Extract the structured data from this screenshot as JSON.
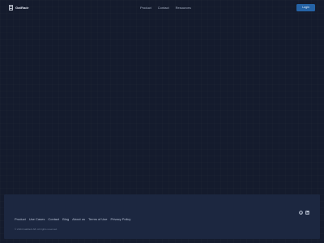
{
  "header": {
    "brand": "GatRadr",
    "nav": [
      "Product",
      "Contact",
      "Resources"
    ],
    "login_label": "Login"
  },
  "footer": {
    "links": [
      "Product",
      "Use Cases",
      "Contact",
      "Blog",
      "About us",
      "Terms of Use",
      "Privacy Policy"
    ],
    "copyright": "© 2024 GatRadr AB. All rights reserved.",
    "social_icons": [
      "github-icon",
      "linkedin-icon"
    ]
  },
  "colors": {
    "background": "#141b2d",
    "footer_background": "#1c2740",
    "accent": "#2563a6"
  }
}
